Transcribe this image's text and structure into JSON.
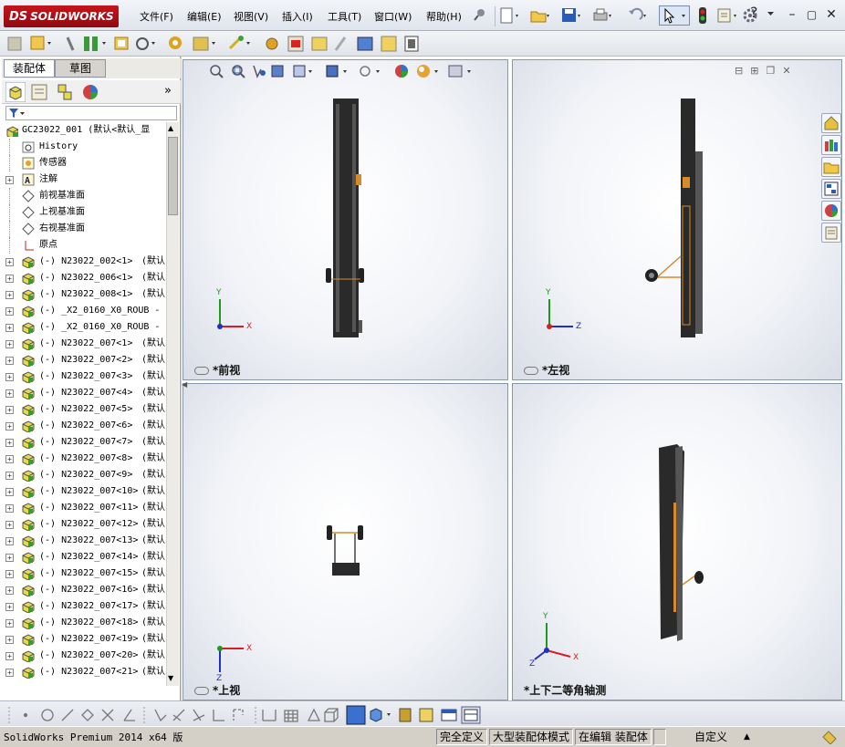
{
  "app": {
    "brand": "SOLIDWORKS",
    "brand_prefix": "DS"
  },
  "menu": [
    "文件(F)",
    "编辑(E)",
    "视图(V)",
    "插入(I)",
    "工具(T)",
    "窗口(W)",
    "帮助(H)"
  ],
  "panel_tabs": [
    "装配体",
    "草图"
  ],
  "tree": {
    "root": "GC23022_001  (默认<默认_显",
    "items": [
      {
        "pm": "",
        "label": "History",
        "extra": ""
      },
      {
        "pm": "",
        "label": "传感器",
        "extra": ""
      },
      {
        "pm": "+",
        "label": "注解",
        "extra": ""
      },
      {
        "pm": "",
        "label": "前视基准面",
        "extra": ""
      },
      {
        "pm": "",
        "label": "上视基准面",
        "extra": ""
      },
      {
        "pm": "",
        "label": "右视基准面",
        "extra": ""
      },
      {
        "pm": "",
        "label": "原点",
        "extra": ""
      },
      {
        "pm": "+",
        "label": "(-) N23022_002<1>",
        "extra": "(默认"
      },
      {
        "pm": "+",
        "label": "(-) N23022_006<1>",
        "extra": "(默认"
      },
      {
        "pm": "+",
        "label": "(-) N23022_008<1>",
        "extra": "(默认"
      },
      {
        "pm": "+",
        "label": "(-) _X2_0160_X0_ROUB -",
        "extra": ""
      },
      {
        "pm": "+",
        "label": "(-) _X2_0160_X0_ROUB -",
        "extra": ""
      },
      {
        "pm": "+",
        "label": "(-) N23022_007<1>",
        "extra": "(默认"
      },
      {
        "pm": "+",
        "label": "(-) N23022_007<2>",
        "extra": "(默认"
      },
      {
        "pm": "+",
        "label": "(-) N23022_007<3>",
        "extra": "(默认"
      },
      {
        "pm": "+",
        "label": "(-) N23022_007<4>",
        "extra": "(默认"
      },
      {
        "pm": "+",
        "label": "(-) N23022_007<5>",
        "extra": "(默认"
      },
      {
        "pm": "+",
        "label": "(-) N23022_007<6>",
        "extra": "(默认"
      },
      {
        "pm": "+",
        "label": "(-) N23022_007<7>",
        "extra": "(默认"
      },
      {
        "pm": "+",
        "label": "(-) N23022_007<8>",
        "extra": "(默认"
      },
      {
        "pm": "+",
        "label": "(-) N23022_007<9>",
        "extra": "(默认"
      },
      {
        "pm": "+",
        "label": "(-) N23022_007<10>",
        "extra": "(默认"
      },
      {
        "pm": "+",
        "label": "(-) N23022_007<11>",
        "extra": "(默认"
      },
      {
        "pm": "+",
        "label": "(-) N23022_007<12>",
        "extra": "(默认"
      },
      {
        "pm": "+",
        "label": "(-) N23022_007<13>",
        "extra": "(默认"
      },
      {
        "pm": "+",
        "label": "(-) N23022_007<14>",
        "extra": "(默认"
      },
      {
        "pm": "+",
        "label": "(-) N23022_007<15>",
        "extra": "(默认"
      },
      {
        "pm": "+",
        "label": "(-) N23022_007<16>",
        "extra": "(默认"
      },
      {
        "pm": "+",
        "label": "(-) N23022_007<17>",
        "extra": "(默认"
      },
      {
        "pm": "+",
        "label": "(-) N23022_007<18>",
        "extra": "(默认"
      },
      {
        "pm": "+",
        "label": "(-) N23022_007<19>",
        "extra": "(默认"
      },
      {
        "pm": "+",
        "label": "(-) N23022_007<20>",
        "extra": "(默认"
      },
      {
        "pm": "+",
        "label": "(-) N23022_007<21>",
        "extra": "(默认"
      }
    ]
  },
  "viewports": {
    "front": "*前视",
    "left": "*左视",
    "top": "*上视",
    "iso": "*上下二等角轴测"
  },
  "axes": {
    "x": "X",
    "y": "Y",
    "z": "Z"
  },
  "status": {
    "product": "SolidWorks Premium 2014 x64 版",
    "defined": "完全定义",
    "mode": "大型装配体模式",
    "editing": "在编辑 装配体",
    "units": "自定义",
    "units_arrow": "▲"
  },
  "colors": {
    "brand_red": "#c7141c",
    "axis_x": "#d42020",
    "axis_y": "#1f9a1f",
    "axis_z": "#2030c0",
    "model_dark": "#2a2a2a",
    "accent_orange": "#d88a2a"
  }
}
